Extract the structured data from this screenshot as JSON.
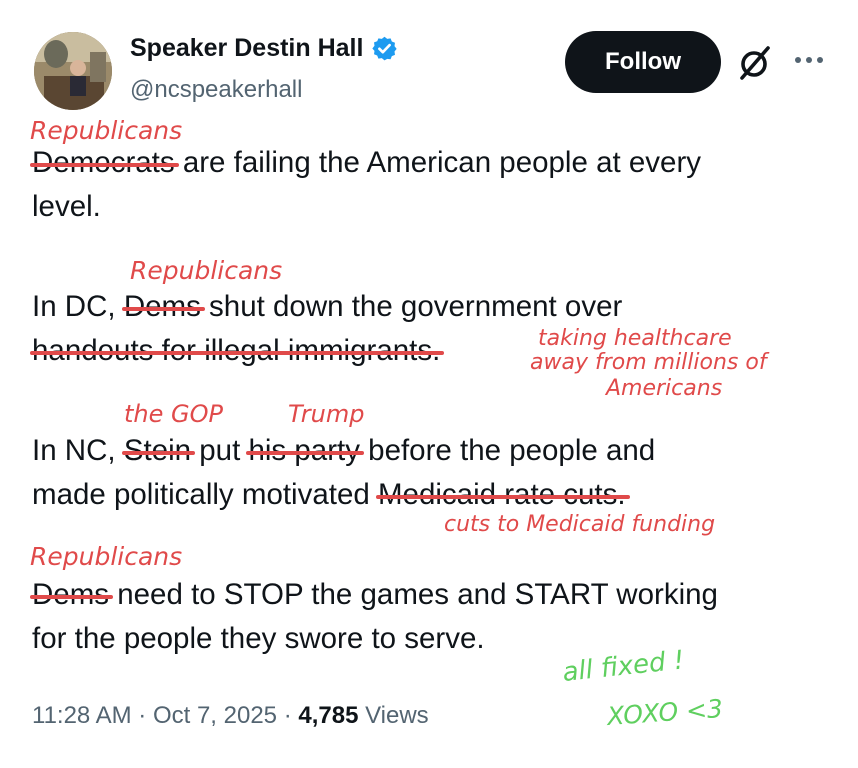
{
  "header": {
    "display_name": "Speaker Destin Hall",
    "handle": "@ncspeakerhall",
    "follow_label": "Follow"
  },
  "icons": {
    "verified": "verified-badge-icon",
    "grok": "grok-icon",
    "more": "more-options-icon"
  },
  "colors": {
    "verified_blue": "#1d9bf0",
    "follow_bg": "#0f1419",
    "annotation_red": "#e04a4a",
    "annotation_green": "#5fcf5f",
    "secondary_text": "#536471"
  },
  "tweet": {
    "p1": {
      "struck": "Democrats",
      "rest": " are failing the American people at every",
      "line2": "level."
    },
    "p2": {
      "prefix": "In DC, ",
      "struck1": "Dems",
      "middle": " shut down the government over",
      "struck2": "handouts for illegal immigrants."
    },
    "p3": {
      "prefix": "In NC, ",
      "struck1": "Stein",
      "word_put": " put ",
      "struck2": "his party",
      "rest": " before the people and",
      "line2_prefix": "made politically motivated ",
      "struck3": "Medicaid rate cuts."
    },
    "p4": {
      "struck": "Dems",
      "rest": " need to STOP the games and START working",
      "line2": "for the people they swore to serve."
    }
  },
  "annotations": {
    "republicans_1": "Republicans",
    "republicans_2": "Republicans",
    "healthcare_1": "taking healthcare",
    "healthcare_2": "away from millions of",
    "healthcare_3": "Americans",
    "the_gop": "the GOP",
    "trump": "Trump",
    "medicaid_funding": "cuts to Medicaid funding",
    "republicans_3": "Republicans",
    "all_fixed": "all fixed !",
    "xoxo": "XOXO <3"
  },
  "meta": {
    "time": "11:28 AM",
    "sep1": " · ",
    "date": "Oct 7, 2025",
    "sep2": " · ",
    "views_count": "4,785",
    "views_label": " Views"
  }
}
